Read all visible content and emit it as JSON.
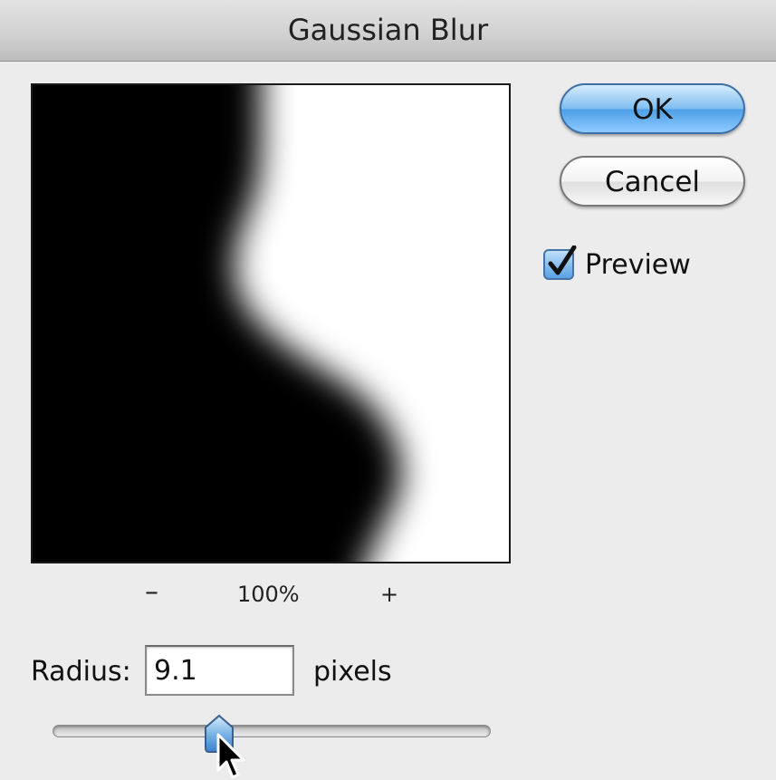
{
  "window": {
    "title": "Gaussian Blur"
  },
  "buttons": {
    "ok": "OK",
    "cancel": "Cancel"
  },
  "preview_option": {
    "label": "Preview",
    "checked": true
  },
  "zoom": {
    "out": "–",
    "level": "100%",
    "in": "+"
  },
  "radius": {
    "label": "Radius:",
    "value": "9.1",
    "units": "pixels",
    "slider_fraction": 0.38
  },
  "colors": {
    "ok_button": "#6fb2ee",
    "check_box": "#5aa0e3",
    "dialog_background": "#ececec"
  },
  "icons": {
    "checkmark": "checkmark-icon",
    "pointer": "mouse-pointer-icon"
  }
}
